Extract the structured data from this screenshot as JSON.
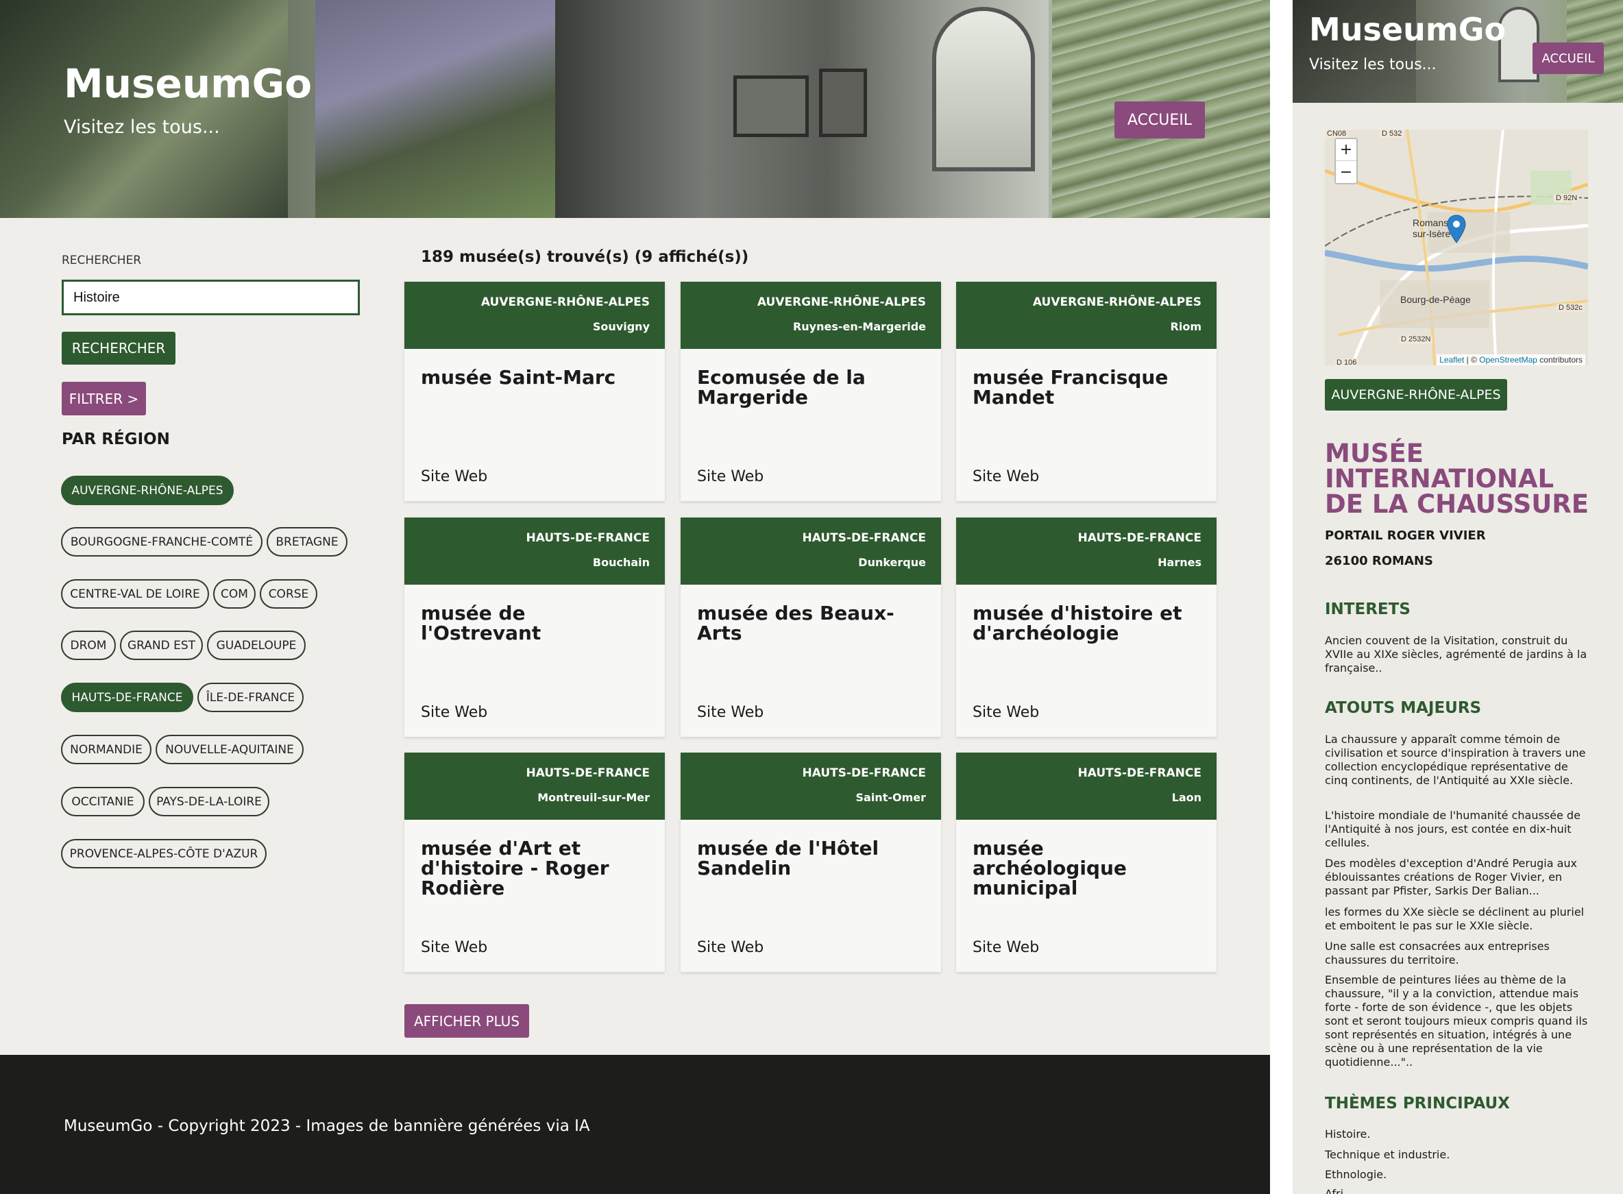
{
  "colors": {
    "green": "#2e5a2f",
    "purple": "#8a4a7c",
    "footer": "#1d1e1c"
  },
  "header": {
    "title": "MuseumGo",
    "subtitle": "Visitez les tous...",
    "home_label": "ACCUEIL"
  },
  "search": {
    "label": "RECHERCHER",
    "value": "Histoire",
    "button_label": "RECHERCHER"
  },
  "filter": {
    "button_label": "FILTRER >",
    "heading": "PAR RÉGION"
  },
  "regions": [
    {
      "label": "AUVERGNE-RHÔNE-ALPES",
      "active": true
    },
    {
      "label": "BOURGOGNE-FRANCHE-COMTÉ",
      "active": false
    },
    {
      "label": "BRETAGNE",
      "active": false
    },
    {
      "label": "CENTRE-VAL DE LOIRE",
      "active": false
    },
    {
      "label": "COM",
      "active": false
    },
    {
      "label": "CORSE",
      "active": false
    },
    {
      "label": "DROM",
      "active": false
    },
    {
      "label": "GRAND EST",
      "active": false
    },
    {
      "label": "GUADELOUPE",
      "active": false
    },
    {
      "label": "HAUTS-DE-FRANCE",
      "active": true
    },
    {
      "label": "ÎLE-DE-FRANCE",
      "active": false
    },
    {
      "label": "NORMANDIE",
      "active": false
    },
    {
      "label": "NOUVELLE-AQUITAINE",
      "active": false
    },
    {
      "label": "OCCITANIE",
      "active": false
    },
    {
      "label": "PAYS-DE-LA-LOIRE",
      "active": false
    },
    {
      "label": "PROVENCE-ALPES-CÔTE D'AZUR",
      "active": false
    }
  ],
  "results": {
    "count_text": "189 musée(s) trouvé(s) (9 affiché(s))"
  },
  "cards": [
    {
      "region": "AUVERGNE-RHÔNE-ALPES",
      "city": "Souvigny",
      "title": "musée Saint-Marc",
      "link": "Site Web"
    },
    {
      "region": "AUVERGNE-RHÔNE-ALPES",
      "city": "Ruynes-en-Margeride",
      "title": "Ecomusée de la Margeride",
      "link": "Site Web"
    },
    {
      "region": "AUVERGNE-RHÔNE-ALPES",
      "city": "Riom",
      "title": "musée Francisque Mandet",
      "link": "Site Web"
    },
    {
      "region": "HAUTS-DE-FRANCE",
      "city": "Bouchain",
      "title": "musée de l'Ostrevant",
      "link": "Site Web"
    },
    {
      "region": "HAUTS-DE-FRANCE",
      "city": "Dunkerque",
      "title": "musée des Beaux-Arts",
      "link": "Site Web"
    },
    {
      "region": "HAUTS-DE-FRANCE",
      "city": "Harnes",
      "title": "musée d'histoire et d'archéologie",
      "link": "Site Web"
    },
    {
      "region": "HAUTS-DE-FRANCE",
      "city": "Montreuil-sur-Mer",
      "title": "musée d'Art et d'histoire - Roger Rodière",
      "link": "Site Web"
    },
    {
      "region": "HAUTS-DE-FRANCE",
      "city": "Saint-Omer",
      "title": "musée de l'Hôtel Sandelin",
      "link": "Site Web"
    },
    {
      "region": "HAUTS-DE-FRANCE",
      "city": "Laon",
      "title": "musée archéologique municipal",
      "link": "Site Web"
    }
  ],
  "more_button": "AFFICHER PLUS",
  "footer": {
    "text": "MuseumGo - Copyright 2023 - Images de bannière générées via IA"
  },
  "panel": {
    "title": "MuseumGo",
    "subtitle": "Visitez les tous...",
    "home_label": "ACCUEIL",
    "map": {
      "zoom_in": "+",
      "zoom_out": "−",
      "attribution_leaflet": "Leaflet",
      "attribution_sep": " | © ",
      "attribution_osm": "OpenStreetMap",
      "attribution_tail": " contributors",
      "place_labels": [
        "Romans-sur-Isère",
        "Bourg-de-Péage"
      ],
      "road_labels": [
        "D 532",
        "D 92N",
        "D 532c",
        "D 2532N",
        "CN08",
        "D 106"
      ]
    },
    "region": "AUVERGNE-RHÔNE-ALPES",
    "museum_name": "MUSÉE INTERNATIONAL DE LA CHAUSSURE",
    "address_line1": "PORTAIL ROGER VIVIER",
    "address_line2": "26100 ROMANS",
    "interets_heading": "INTERETS",
    "interets_text": "Ancien couvent de la Visitation, construit du XVIIe au XIXe siècles, agrémenté de jardins à la française..",
    "atouts_heading": "ATOUTS MAJEURS",
    "atouts": [
      "La chaussure y apparaît comme témoin de civilisation et source d'inspiration à travers une collection encyclopédique représentative de cinq continents, de l'Antiquité au XXIe siècle.",
      "L'histoire mondiale de l'humanité chaussée de l'Antiquité à nos jours, est contée en dix-huit cellules.",
      "Des modèles d'exception d'André Perugia aux éblouissantes créations de Roger Vivier, en passant par Pfister, Sarkis Der Balian...",
      "les formes du XXe siècle se déclinent au pluriel et emboitent le pas sur le XXIe siècle.",
      "Une salle est consacrées aux entreprises chaussures du territoire.",
      "Ensemble de peintures liées au thème de la chaussure, \"il y a la conviction, attendue mais forte - forte de son évidence -, que les objets sont et seront toujours mieux compris quand ils sont représentés en situation, intégrés à une scène ou à une représentation de la vie quotidienne...\".."
    ],
    "themes_heading": "THÈMES PRINCIPAUX",
    "themes": [
      "Histoire.",
      "Technique et industrie.",
      "Ethnologie.",
      "Afri..."
    ]
  }
}
